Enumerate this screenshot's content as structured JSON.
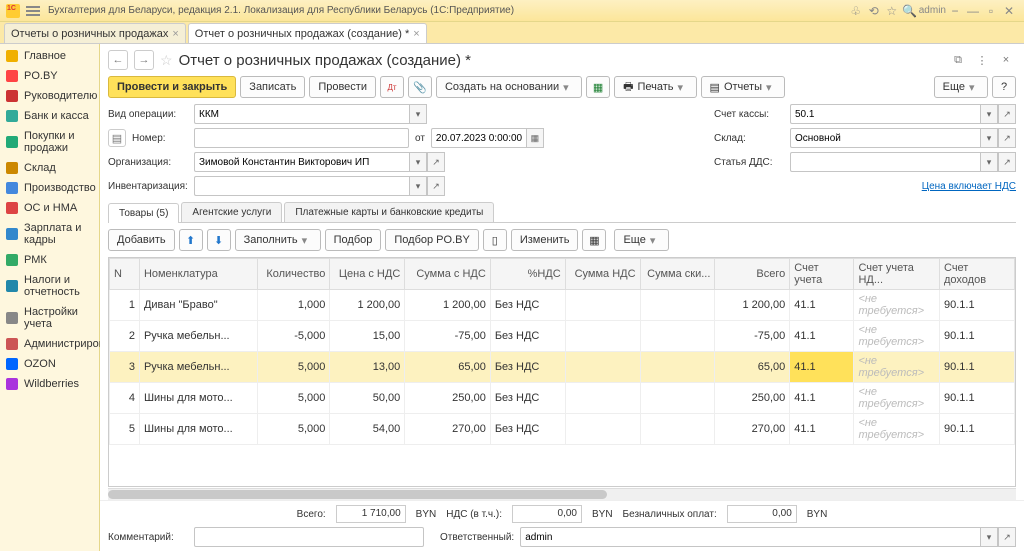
{
  "top": {
    "title": "Бухгалтерия для Беларуси, редакция 2.1. Локализация для Республики Беларусь   (1С:Предприятие)",
    "user": "admin"
  },
  "tabs": [
    {
      "label": "Отчеты о розничных продажах"
    },
    {
      "label": "Отчет о розничных продажах (создание) *"
    }
  ],
  "side": [
    {
      "label": "Главное",
      "c": "#f0b000"
    },
    {
      "label": "PO.BY",
      "c": "#f44"
    },
    {
      "label": "Руководителю",
      "c": "#c33"
    },
    {
      "label": "Банк и касса",
      "c": "#3a9"
    },
    {
      "label": "Покупки и продажи",
      "c": "#2a7"
    },
    {
      "label": "Склад",
      "c": "#c80"
    },
    {
      "label": "Производство",
      "c": "#48d"
    },
    {
      "label": "ОС и НМА",
      "c": "#d44"
    },
    {
      "label": "Зарплата и кадры",
      "c": "#38c"
    },
    {
      "label": "РМК",
      "c": "#3a6"
    },
    {
      "label": "Налоги и отчетность",
      "c": "#28a"
    },
    {
      "label": "Настройки учета",
      "c": "#888"
    },
    {
      "label": "Администрирование",
      "c": "#c55"
    },
    {
      "label": "OZON",
      "c": "#06f"
    },
    {
      "label": "Wildberries",
      "c": "#a3d"
    }
  ],
  "page": {
    "title": "Отчет о розничных продажах (создание) *"
  },
  "toolbar": {
    "postclose": "Провести и закрыть",
    "write": "Записать",
    "post": "Провести",
    "create": "Создать на основании",
    "print": "Печать",
    "reports": "Отчеты",
    "more": "Еще"
  },
  "form": {
    "vidOpLbl": "Вид операции:",
    "vidOp": "ККМ",
    "nomerLbl": "Номер:",
    "otLbl": "от",
    "date": "20.07.2023 0:00:00",
    "schetLbl": "Счет кассы:",
    "schet": "50.1",
    "skladLbl": "Склад:",
    "sklad": "Основной",
    "orgLbl": "Организация:",
    "org": "Зимовой Константин Викторович ИП",
    "ddsLbl": "Статья ДДС:",
    "invLbl": "Инвентаризация:",
    "ndsLink": "Цена включает НДС"
  },
  "dtabs": [
    "Товары (5)",
    "Агентские услуги",
    "Платежные карты и банковские кредиты"
  ],
  "tblTools": {
    "add": "Добавить",
    "fill": "Заполнить",
    "podbor": "Подбор",
    "podborpo": "Подбор PO.BY",
    "change": "Изменить",
    "more": "Еще"
  },
  "cols": [
    "N",
    "Номенклатура",
    "Количество",
    "Цена с НДС",
    "Сумма с НДС",
    "%НДС",
    "Сумма НДС",
    "Сумма ски...",
    "Всего",
    "Счет учета",
    "Счет учета НД...",
    "Счет доходов"
  ],
  "rows": [
    {
      "n": 1,
      "nom": "Диван \"Браво\"",
      "qty": "1,000",
      "price": "1 200,00",
      "sum": "1 200,00",
      "nds": "Без НДС",
      "total": "1 200,00",
      "acc": "41.1",
      "accnds": "<не требуется>",
      "accinc": "90.1.1"
    },
    {
      "n": 2,
      "nom": "Ручка мебельн...",
      "qty": "-5,000",
      "price": "15,00",
      "sum": "-75,00",
      "nds": "Без НДС",
      "total": "-75,00",
      "acc": "41.1",
      "accnds": "<не требуется>",
      "accinc": "90.1.1"
    },
    {
      "n": 3,
      "nom": "Ручка мебельн...",
      "qty": "5,000",
      "price": "13,00",
      "sum": "65,00",
      "nds": "Без НДС",
      "total": "65,00",
      "acc": "41.1",
      "accnds": "<не требуется>",
      "accinc": "90.1.1",
      "sel": true
    },
    {
      "n": 4,
      "nom": "Шины для мото...",
      "qty": "5,000",
      "price": "50,00",
      "sum": "250,00",
      "nds": "Без НДС",
      "total": "250,00",
      "acc": "41.1",
      "accnds": "<не требуется>",
      "accinc": "90.1.1"
    },
    {
      "n": 5,
      "nom": "Шины для мото...",
      "qty": "5,000",
      "price": "54,00",
      "sum": "270,00",
      "nds": "Без НДС",
      "total": "270,00",
      "acc": "41.1",
      "accnds": "<не требуется>",
      "accinc": "90.1.1"
    }
  ],
  "totals": {
    "vsegoLbl": "Всего:",
    "vsego": "1 710,00",
    "c1": "BYN",
    "ndsLbl": "НДС (в т.ч.):",
    "nds": "0,00",
    "c2": "BYN",
    "bezLbl": "Безналичных оплат:",
    "bez": "0,00",
    "c3": "BYN"
  },
  "foot": {
    "commLbl": "Комментарий:",
    "respLbl": "Ответственный:",
    "resp": "admin"
  }
}
